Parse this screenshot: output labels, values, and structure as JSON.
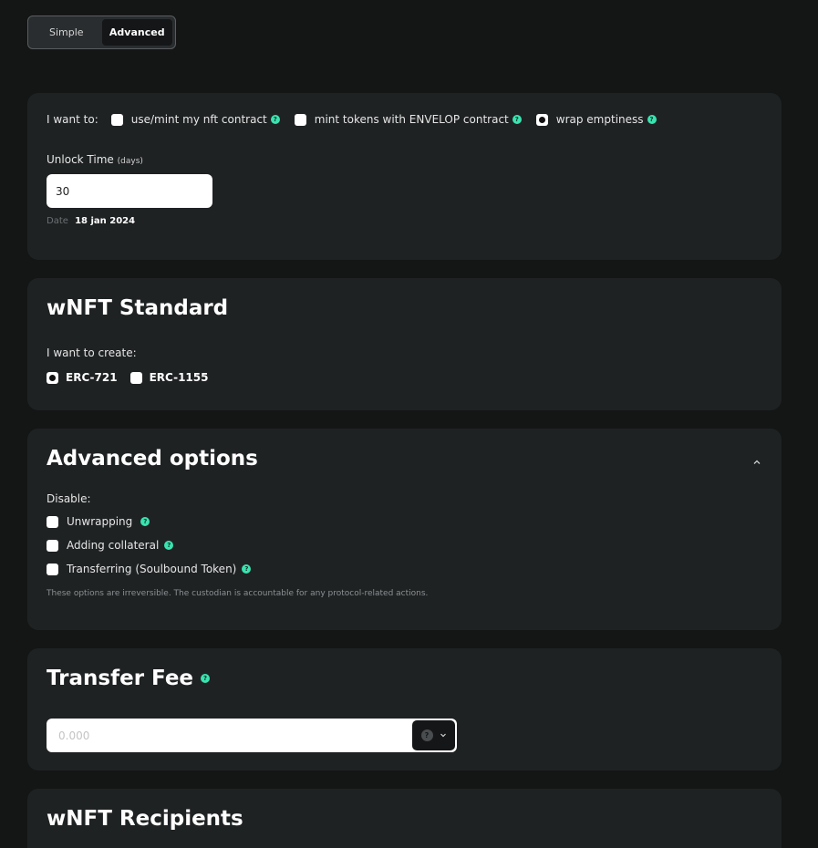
{
  "mode_toggle": {
    "simple": "Simple",
    "advanced": "Advanced",
    "active": "Advanced"
  },
  "wrap_options": {
    "label": "I want to:",
    "use_mint": "use/mint my nft contract",
    "mint_envelop": "mint tokens with ENVELOP contract",
    "wrap_emptiness": "wrap emptiness",
    "selected": "wrap emptiness"
  },
  "unlock": {
    "label": "Unlock Time",
    "unit": "(days)",
    "value": "30",
    "date_label": "Date",
    "date_value": "18 jan 2024"
  },
  "standard": {
    "title": "wNFT Standard",
    "create_label": "I want to create:",
    "erc721": "ERC-721",
    "erc1155": "ERC-1155",
    "selected": "ERC-721"
  },
  "advanced": {
    "title": "Advanced options",
    "disable_label": "Disable:",
    "items": [
      "Unwrapping",
      "Adding collateral",
      "Transferring (Soulbound Token)"
    ],
    "note": "These options are irreversible. The custodian is accountable for any protocol-related actions."
  },
  "transfer_fee": {
    "title": "Transfer Fee",
    "placeholder": "0.000"
  },
  "recipients": {
    "title": "wNFT Recipients"
  },
  "colors": {
    "accent": "#3ae3b0",
    "card_bg": "#1f2223",
    "page_bg": "#141515"
  },
  "icons": {
    "help": "question-circle-icon",
    "collapse": "chevron-up-icon",
    "dropdown": "chevron-down-icon"
  }
}
